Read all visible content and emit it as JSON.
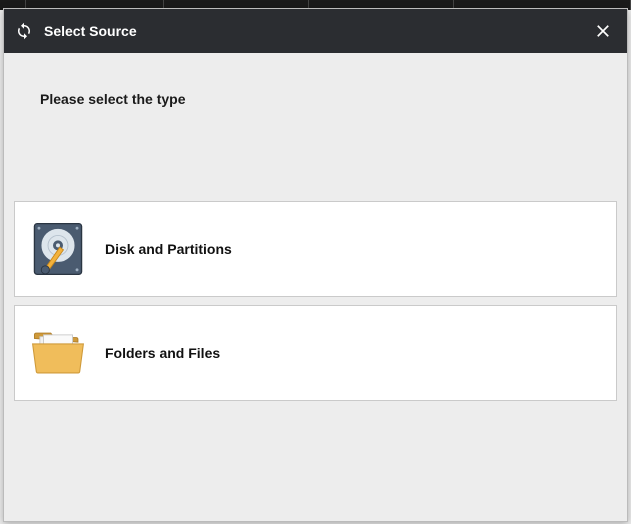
{
  "header": {
    "title": "Select Source"
  },
  "body": {
    "instruction": "Please select the type"
  },
  "options": [
    {
      "label": "Disk and Partitions"
    },
    {
      "label": "Folders and Files"
    }
  ]
}
